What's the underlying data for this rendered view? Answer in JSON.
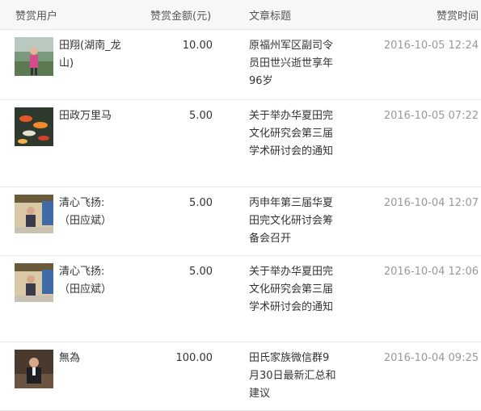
{
  "header": {
    "user": "赞赏用户",
    "amount": "赞赏金额(元)",
    "title": "文章标题",
    "time": "赞赏时间"
  },
  "rows": [
    {
      "user": "田翔(湖南_龙山)",
      "amount": "10.00",
      "title": "原福州军区副司令员田世兴逝世享年96岁",
      "time": "2016-10-05 12:24",
      "avatar": "person-outdoors-avatar"
    },
    {
      "user": "田政万里马",
      "amount": "5.00",
      "title": "关于举办华夏田完文化研究会第三届学术研讨会的通知",
      "time": "2016-10-05 07:22",
      "avatar": "koi-fish-avatar"
    },
    {
      "user": "清心飞扬:（田应斌）",
      "amount": "5.00",
      "title": "丙申年第三届华夏田完文化研讨会筹备会召开",
      "time": "2016-10-04 12:07",
      "avatar": "person-indoor-avatar"
    },
    {
      "user": "清心飞扬:（田应斌）",
      "amount": "5.00",
      "title": "关于举办华夏田完文化研究会第三届学术研讨会的通知",
      "time": "2016-10-04 12:06",
      "avatar": "person-indoor-avatar"
    },
    {
      "user": "無為",
      "amount": "100.00",
      "title": "田氏家族微信群9月30日最新汇总和建议",
      "time": "2016-10-04 09:25",
      "avatar": "man-seated-avatar"
    }
  ]
}
